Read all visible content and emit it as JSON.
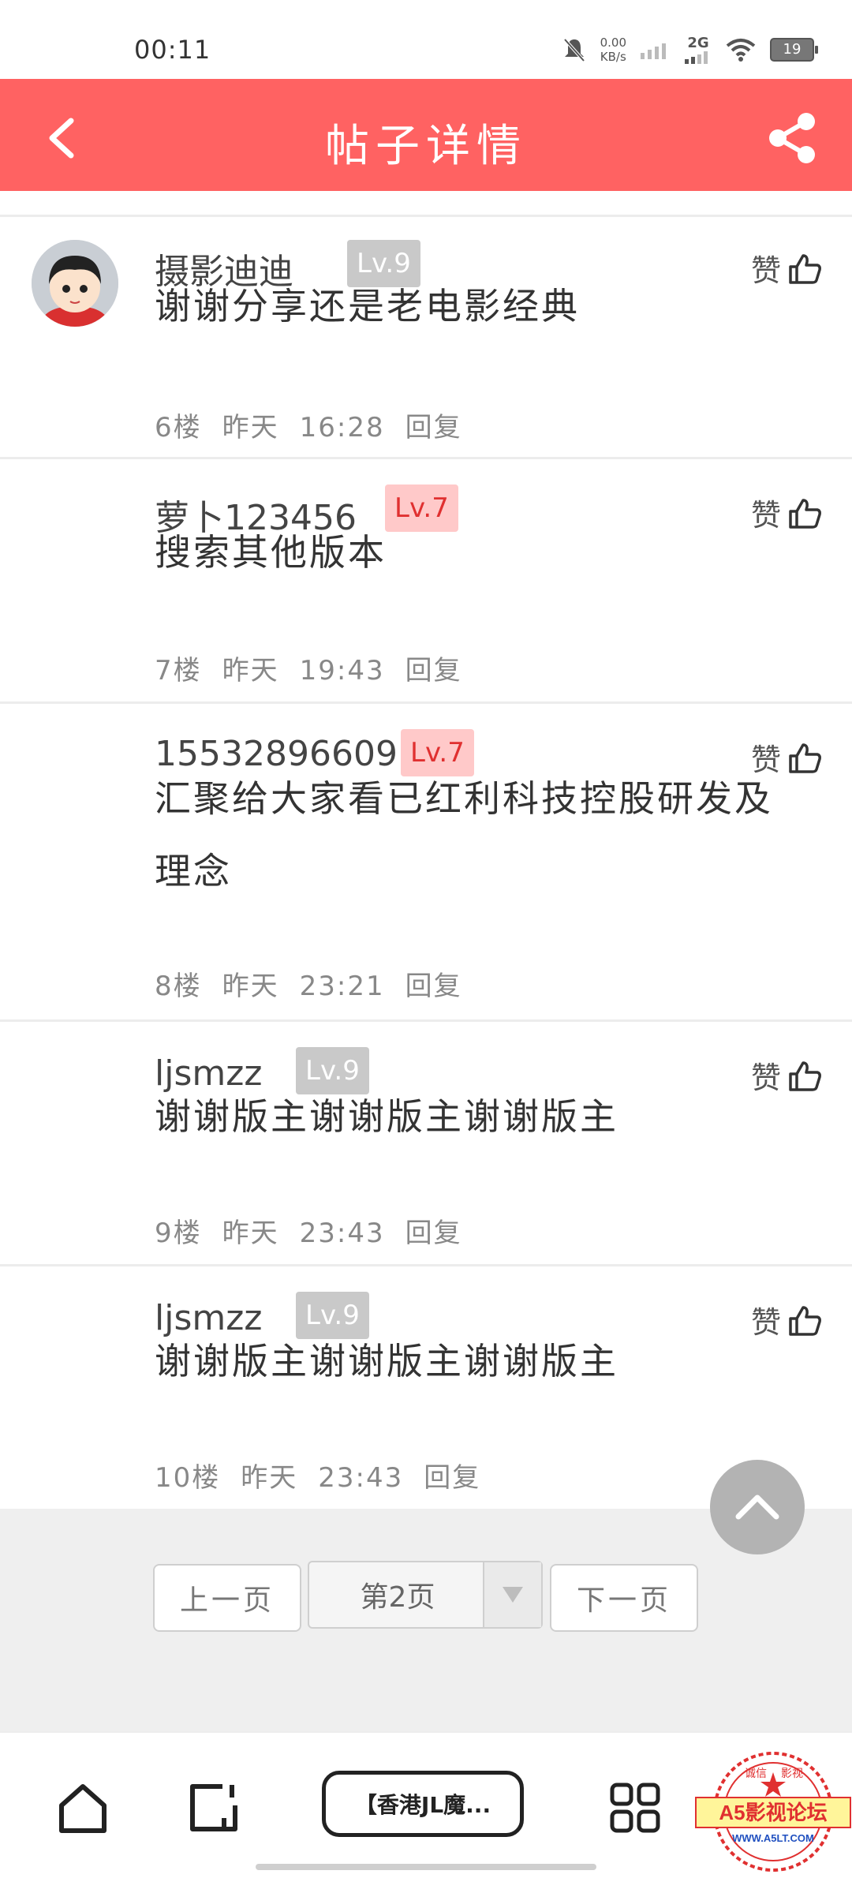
{
  "status_bar": {
    "time": "00:11",
    "net_speed_value": "0.00",
    "net_speed_unit": "KB/s",
    "network": "2G",
    "battery": "19"
  },
  "header": {
    "title": "帖子详情"
  },
  "posts": [
    {
      "username": "摄影迪迪",
      "level": "Lv.9",
      "like_label": "赞",
      "content": "谢谢分享还是老电影经典",
      "floor": "6楼",
      "day": "昨天",
      "time": "16:28",
      "reply": "回复"
    },
    {
      "username": "萝卜123456",
      "level": "Lv.7",
      "like_label": "赞",
      "content": "搜索其他版本",
      "floor": "7楼",
      "day": "昨天",
      "time": "19:43",
      "reply": "回复"
    },
    {
      "username": "15532896609",
      "level": "Lv.7",
      "like_label": "赞",
      "content": "汇聚给大家看已红利科技控股研发及理念",
      "floor": "8楼",
      "day": "昨天",
      "time": "23:21",
      "reply": "回复"
    },
    {
      "username": "ljsmzz",
      "level": "Lv.9",
      "like_label": "赞",
      "content": "谢谢版主谢谢版主谢谢版主",
      "floor": "9楼",
      "day": "昨天",
      "time": "23:43",
      "reply": "回复"
    },
    {
      "username": "ljsmzz",
      "level": "Lv.9",
      "like_label": "赞",
      "content": "谢谢版主谢谢版主谢谢版主",
      "floor": "10楼",
      "day": "昨天",
      "time": "23:43",
      "reply": "回复"
    }
  ],
  "pager": {
    "prev": "上一页",
    "current": "第2页",
    "next": "下一页"
  },
  "bottom_bar": {
    "title": "【香港JL魔...",
    "watermark_main": "A5影视论坛",
    "watermark_url": "WWW.A5LT.COM",
    "watermark_top_left": "诚信",
    "watermark_top_right": "影视"
  },
  "icons": [
    "back-icon",
    "share-icon",
    "thumbs-up-icon",
    "scroll-top-icon",
    "home-icon",
    "edit-icon",
    "grid-icon",
    "dropdown-arrow-icon"
  ],
  "colors": {
    "header": "#ff6262",
    "level_pink_bg": "#ffc9c9",
    "level_pink_text": "#e03030",
    "level_gray_bg": "#c9c9c9"
  }
}
